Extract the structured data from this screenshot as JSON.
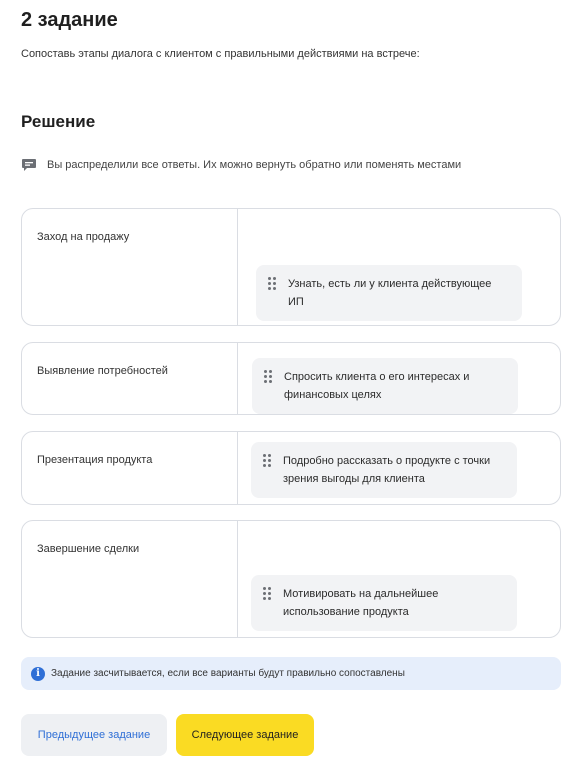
{
  "task": {
    "title": "2 задание",
    "instruction": "Сопоставь этапы диалога с клиентом с правильными действиями на встрече:"
  },
  "solution": {
    "title": "Решение",
    "hint_icon": "chat-bubble-icon",
    "hint_text": "Вы распределили все ответы. Их можно вернуть обратно или поменять местами"
  },
  "matches": [
    {
      "stage": "Заход на продажу",
      "answer": "Узнать, есть ли у клиента действующее ИП"
    },
    {
      "stage": "Выявление потребностей",
      "answer": "Спросить клиента о его интересах и финансовых целях"
    },
    {
      "stage": "Презентация продукта",
      "answer": "Подробно рассказать о продукте с точки зрения выгоды для клиента"
    },
    {
      "stage": "Завершение сделки",
      "answer": "Мотивировать на дальнейшее использование продукта"
    }
  ],
  "info": {
    "icon": "info-icon",
    "text": "Задание засчитывается, если все варианты будут правильно сопоставлены"
  },
  "buttons": {
    "prev_label": "Предыдущее задание",
    "next_label": "Следующее задание"
  },
  "colors": {
    "accent_yellow": "#fadb23",
    "link_blue": "#2f6fd6",
    "info_bg": "#e6eefb",
    "chip_bg": "#f2f3f5",
    "border": "#dadde3"
  }
}
